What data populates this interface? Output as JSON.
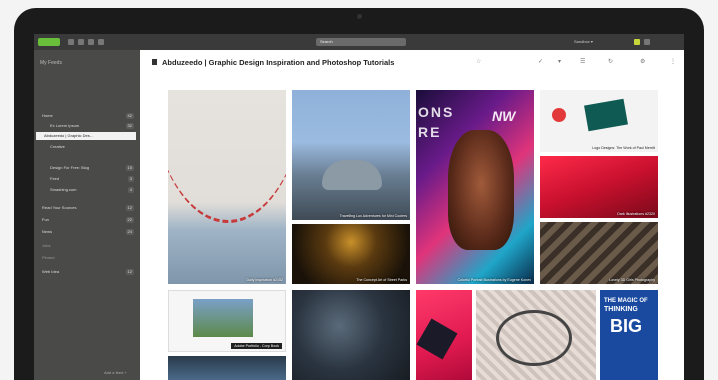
{
  "topbar": {
    "search_text": "Search",
    "account_label": "Sandbox ▾"
  },
  "sidebar": {
    "title": "My Feeds",
    "items": [
      {
        "label": "Home",
        "count": "42"
      },
      {
        "label": "Ex Lorem Ipsum",
        "count": "32"
      },
      {
        "label": "Abduzeedo | Graphic Des…",
        "count": "14"
      },
      {
        "label": "Creative",
        "count": ""
      },
      {
        "label": "Design For Free: Blog",
        "count": "15"
      },
      {
        "label": "Feed",
        "count": "3"
      },
      {
        "label": "Smashing.com",
        "count": "4"
      },
      {
        "label": "Read Your Sources",
        "count": "12"
      },
      {
        "label": "Fun",
        "count": "22"
      },
      {
        "label": "News",
        "count": "24"
      },
      {
        "label": "Jobs",
        "count": ""
      },
      {
        "label": "Pinned",
        "count": ""
      },
      {
        "label": "Web Idea",
        "count": "12"
      }
    ],
    "footer": "Add a feed +"
  },
  "main": {
    "title": "Abduzeedo | Graphic Design Inspiration and Photoshop Tutorials"
  },
  "tiles": [
    {
      "caption": "Daily Inspiration #2152"
    },
    {
      "caption": "Travelling Lux Adventures for Mini Coolers"
    },
    {
      "caption": "The Concept Art of Street Parks"
    },
    {
      "caption": "Colorful Portrait Illustrations by Eugene Konev"
    },
    {
      "caption": "Logo Designs: The Work of Paul Merritt"
    },
    {
      "caption": "Dark Illustrations #2320"
    },
    {
      "caption": "Lovely 3D Girls Photography"
    },
    {
      "caption": "Adobe Portfolio - Corp Book"
    },
    {
      "caption": "THE MAGIC OF THINKING BIG",
      "line1": "THE MAGIC OF",
      "line2": "THINKING",
      "line3": "BIG"
    }
  ],
  "poster_text": {
    "n": "NW",
    "ons": "ONS",
    "re": "RE"
  }
}
